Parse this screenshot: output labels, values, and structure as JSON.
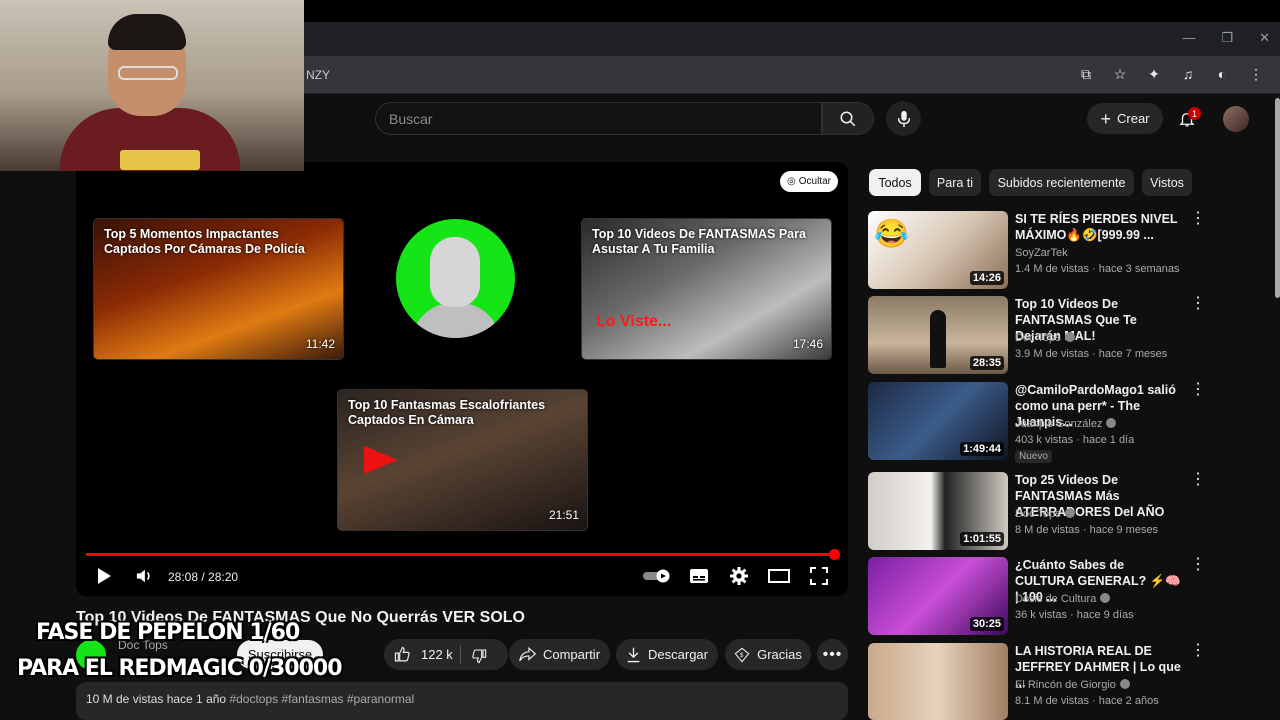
{
  "browser": {
    "url_fragment": "NZY",
    "window_controls": [
      "—",
      "❐",
      "✕"
    ]
  },
  "header": {
    "search_placeholder": "Buscar",
    "create_label": "Crear",
    "notification_count": "1"
  },
  "player": {
    "hide_label": "Ocultar",
    "time": "28:08 / 28:20",
    "progress_fraction": 1.0,
    "endcards": [
      {
        "title": "Top 5 Momentos Impactantes Captados Por Cámaras De Policía",
        "duration": "11:42"
      },
      {
        "title": "Top 10 Videos De FANTASMAS Para Asustar A Tu Familia",
        "duration": "17:46",
        "overlay_text": "Lo Viste..."
      },
      {
        "title": "Top 10 Fantasmas Escalofriantes Captados En Cámara",
        "duration": "21:51"
      }
    ]
  },
  "video": {
    "title": "Top 10 Videos De FANTASMAS Que No Querrás VER SOLO",
    "channel": "Doc Tops",
    "subscribe_label": "Suscribirse",
    "likes": "122 k",
    "share_label": "Compartir",
    "download_label": "Descargar",
    "thanks_label": "Gracias",
    "views_date": "10 M de vistas  hace 1 año",
    "hashtags": "#doctops #fantasmas #paranormal"
  },
  "overlay": {
    "line1": "FASE DE PEPELON 1/60",
    "line2": "PARA EL REDMAGIC 0/30000"
  },
  "sidebar": {
    "chips": [
      "Todos",
      "Para ti",
      "Subidos recientemente",
      "Vistos"
    ],
    "active_chip": "Todos",
    "recs": [
      {
        "title": "SI TE RÍES PIERDES NIVEL MÁXIMO🔥🤣[999.99 ...",
        "channel": "SoyZarTek",
        "meta": "1.4 M de vistas · hace 3 semanas",
        "duration": "14:26",
        "verified": false
      },
      {
        "title": "Top 10 Videos De FANTASMAS Que Te Dejarán MAL!",
        "channel": "Doc Tops",
        "meta": "3.9 M de vistas · hace 7 meses",
        "duration": "28:35",
        "verified": true
      },
      {
        "title": "@CamiloPardoMago1 salió como una perr* - The Juanpis...",
        "channel": "Juanpis González",
        "meta": "403 k vistas · hace 1 día",
        "duration": "1:49:44",
        "verified": true,
        "badge": "Nuevo"
      },
      {
        "title": "Top 25 Videos De FANTASMAS Más ATERRADORES Del AÑO",
        "channel": "Doc Tops",
        "meta": "8 M de vistas · hace 9 meses",
        "duration": "1:01:55",
        "verified": true
      },
      {
        "title": "¿Cuánto Sabes de CULTURA GENERAL? ⚡🧠 | 100 ...",
        "channel": "Dosis de Cultura",
        "meta": "36 k vistas · hace 9 días",
        "duration": "30:25",
        "verified": true
      },
      {
        "title": "LA HISTORIA REAL DE JEFFREY DAHMER | Lo que ...",
        "channel": "El Rincón de Giorgio",
        "meta": "8.1 M de vistas · hace 2 años",
        "duration": "",
        "verified": true
      }
    ]
  }
}
